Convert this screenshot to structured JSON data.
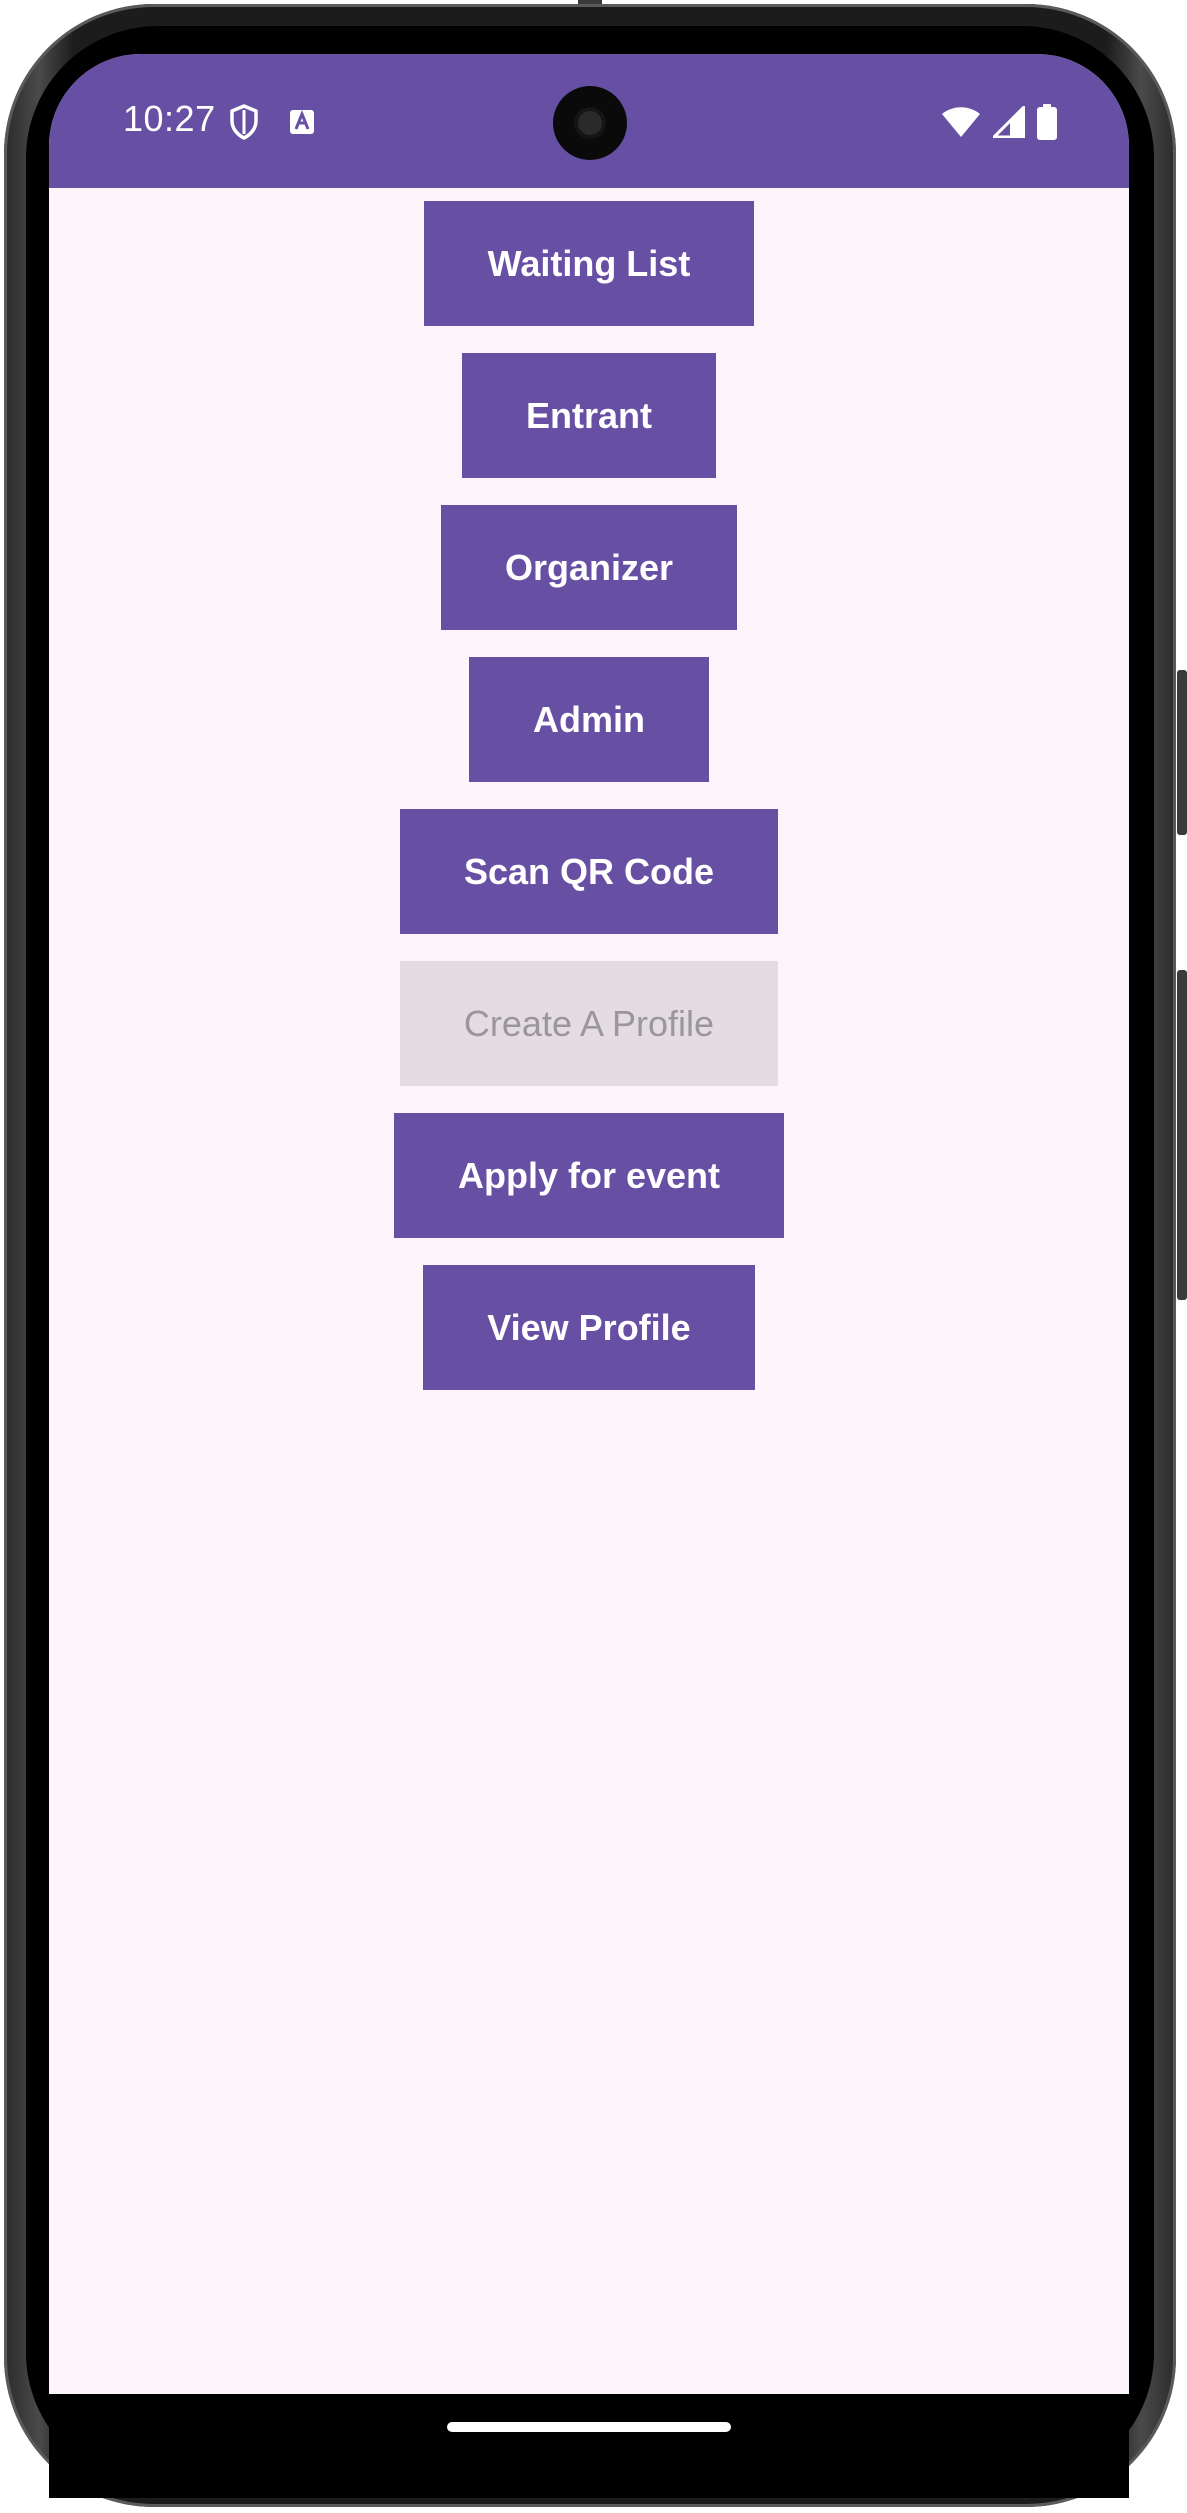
{
  "status_bar": {
    "time": "10:27",
    "left_icons": [
      "shield-icon",
      "keyboard-a-icon"
    ],
    "right_icons": [
      "wifi-icon",
      "cellular-signal-icon",
      "battery-icon"
    ],
    "color": "#6750a4"
  },
  "main": {
    "buttons": [
      {
        "label": "Waiting List",
        "enabled": true
      },
      {
        "label": "Entrant",
        "enabled": true
      },
      {
        "label": "Organizer",
        "enabled": true
      },
      {
        "label": "Admin",
        "enabled": true
      },
      {
        "label": "Scan QR Code",
        "enabled": true
      },
      {
        "label": "Create A Profile",
        "enabled": false
      },
      {
        "label": "Apply for event",
        "enabled": true
      },
      {
        "label": "View Profile",
        "enabled": true
      }
    ]
  },
  "colors": {
    "primary": "#6750a4",
    "background": "#fcf5fb",
    "disabled_bg": "#e3dde3",
    "disabled_text": "#9a969b"
  }
}
